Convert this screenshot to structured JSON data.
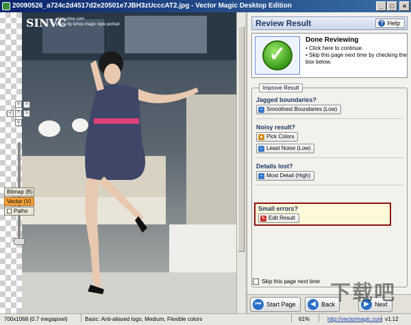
{
  "window": {
    "title": "20090526_a724c2d4517d2e20501e7JBH3zUcccAT2.jpg - Vector Magic Desktop Edition",
    "buttons": [
      "_",
      "□",
      "×"
    ]
  },
  "photo": {
    "watermark": "SINVC",
    "credit_lines": [
      "www.sinvc.com",
      "photo by lizhou magic style portrait"
    ]
  },
  "zoom": {
    "buttons": [
      "+",
      "×",
      "<",
      ">",
      "^",
      "v"
    ]
  },
  "modes": {
    "bitmap": "Bitmap (B)",
    "vector": "Vector (V)",
    "paths": "Paths"
  },
  "panel": {
    "title": "Review Result",
    "help": "Help",
    "done": {
      "title": "Done Reviewing",
      "items": [
        "Click here to continue.",
        "Skip this page next time by checking the box below."
      ]
    },
    "improve": {
      "legend": "Improve Result",
      "jagged": {
        "title": "Jagged boundaries?",
        "button": "Smoothest Boundaries (Low)"
      },
      "noisy": {
        "title": "Noisy result?",
        "pick": "Pick Colors",
        "least": "Least Noise (Low)"
      },
      "details": {
        "title": "Details lost?",
        "button": "Most Detail (High)"
      },
      "errors": {
        "title": "Small errors?",
        "button": "Edit Result"
      }
    },
    "skip": "Skip this page next time",
    "nav": {
      "start": "Start Page",
      "back": "Back",
      "next": "Next"
    }
  },
  "status": {
    "dimensions": "700x1068 (0.7 megapixel)",
    "settings": "Basic: Anti-aliased logo, Medium, Flexible colors",
    "zoom": "61%",
    "url": "http://vectormagic.com",
    "version": "v1.12"
  }
}
